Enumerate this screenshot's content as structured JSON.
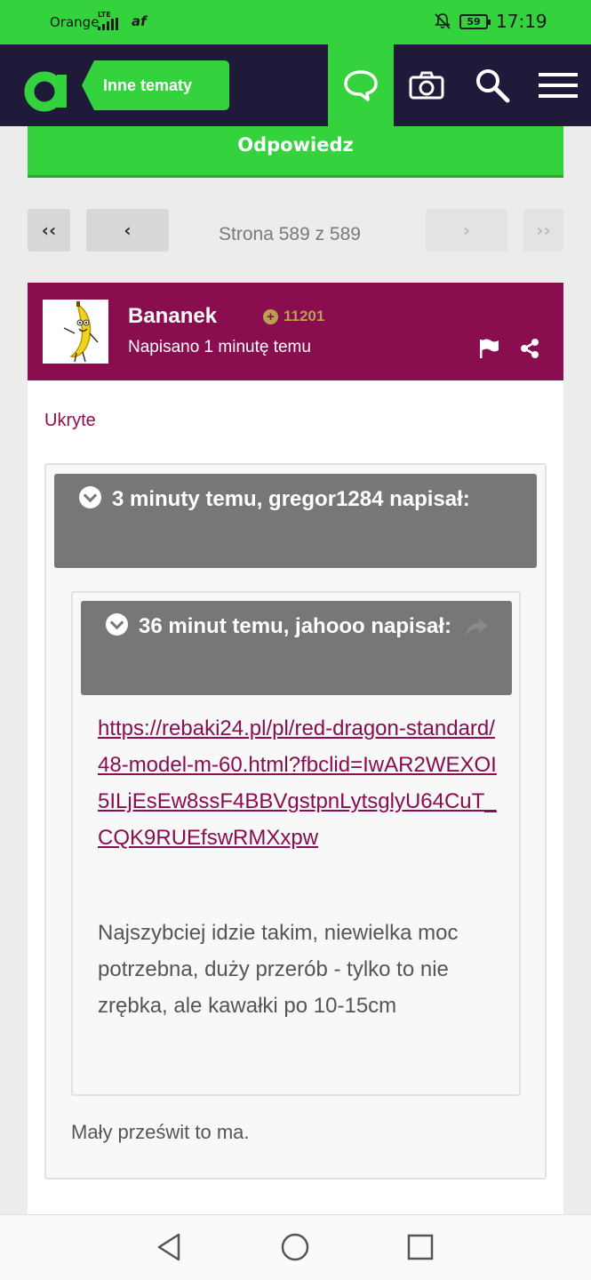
{
  "status_bar": {
    "carrier": "Orange",
    "network": "LTE",
    "extra": "af",
    "battery": "59",
    "time": "17:19"
  },
  "navbar": {
    "logo": "a",
    "section": "Inne tematy",
    "icons": [
      "chat-icon",
      "camera-icon",
      "search-icon",
      "menu-icon"
    ]
  },
  "reply_button": "Odpowiedz",
  "pagination": {
    "first": "‹‹",
    "prev": "‹",
    "label": "Strona 589 z 589",
    "next": "›",
    "last": "››"
  },
  "post": {
    "author": "Bananek",
    "reputation": "11201",
    "posted": "Napisano 1 minutę temu",
    "hidden_label": "Ukryte",
    "quote_outer": {
      "header": "3 minuty temu, gregor1284 napisał:"
    },
    "quote_inner": {
      "header": "36 minut temu, jahooo napisał:",
      "link": "https://rebaki24.pl/pl/red-dragon-standard/48-model-m-60.html?fbclid=IwAR2WEXOI5ILjEsEw8ssF4BBVgstpnLytsglyU64CuT_CQK9RUEfswRMXxpw",
      "text": "Najszybciej idzie takim, niewielka moc potrzebna, duży przerób - tylko to nie zrębka, ale kawałki po 10-15cm"
    },
    "reply_text": "Mały prześwit to ma."
  },
  "colors": {
    "brand_green": "#34d23c",
    "nav_dark": "#1f1a3a",
    "post_header": "#8a0d4f",
    "quote_header": "#777777"
  }
}
